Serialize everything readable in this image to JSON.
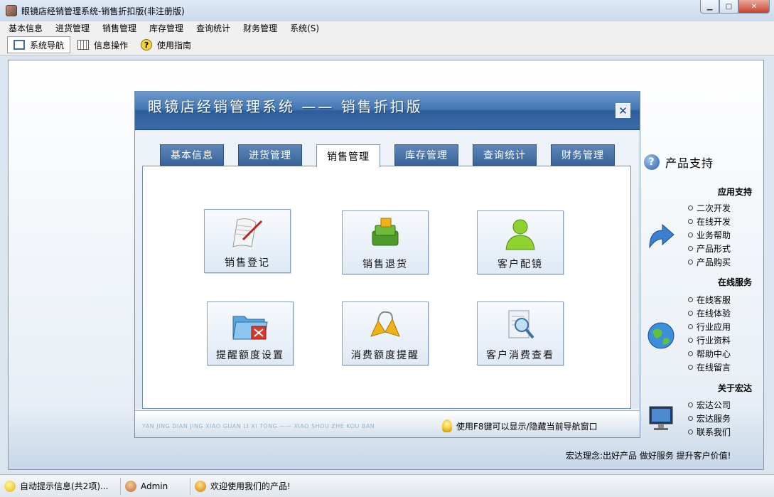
{
  "window": {
    "title": "眼镜店经销管理系统-销售折扣版(非注册版)"
  },
  "menu": [
    "基本信息",
    "进货管理",
    "销售管理",
    "库存管理",
    "查询统计",
    "财务管理",
    "系统(S)"
  ],
  "toolbar": {
    "nav": "系统导航",
    "info": "信息操作",
    "help": "使用指南"
  },
  "nav": {
    "title": "眼镜店经销管理系统 —— 销售折扣版",
    "tabs": [
      "基本信息",
      "进货管理",
      "销售管理",
      "库存管理",
      "查询统计",
      "财务管理"
    ],
    "active_tab": "销售管理",
    "functions": [
      "销售登记",
      "销售退货",
      "客户配镜",
      "提醒额度设置",
      "消费额度提醒",
      "客户消费查看"
    ],
    "footer_pinyin": "YAN JING DIAN JING XIAO GUAN LI XI TONG —— XIAO SHOU ZHE KOU BAN",
    "footer_hint": "使用F8键可以显示/隐藏当前导航窗口"
  },
  "support": {
    "title": "产品支持",
    "groups": [
      {
        "head": "应用支持",
        "items": [
          "二次开发",
          "在线开发",
          "业务帮助",
          "产品形式",
          "产品购买"
        ]
      },
      {
        "head": "在线服务",
        "items": [
          "在线客服",
          "在线体验",
          "行业应用",
          "行业资料",
          "帮助中心",
          "在线留言"
        ]
      },
      {
        "head": "关于宏达",
        "items": [
          "宏达公司",
          "宏达服务",
          "联系我们"
        ]
      }
    ],
    "motto": "宏达理念:出好产品 做好服务 提升客户价值!"
  },
  "status": {
    "tips": "自动提示信息(共2项)...",
    "user": "Admin",
    "welcome": "欢迎使用我们的产品!"
  }
}
